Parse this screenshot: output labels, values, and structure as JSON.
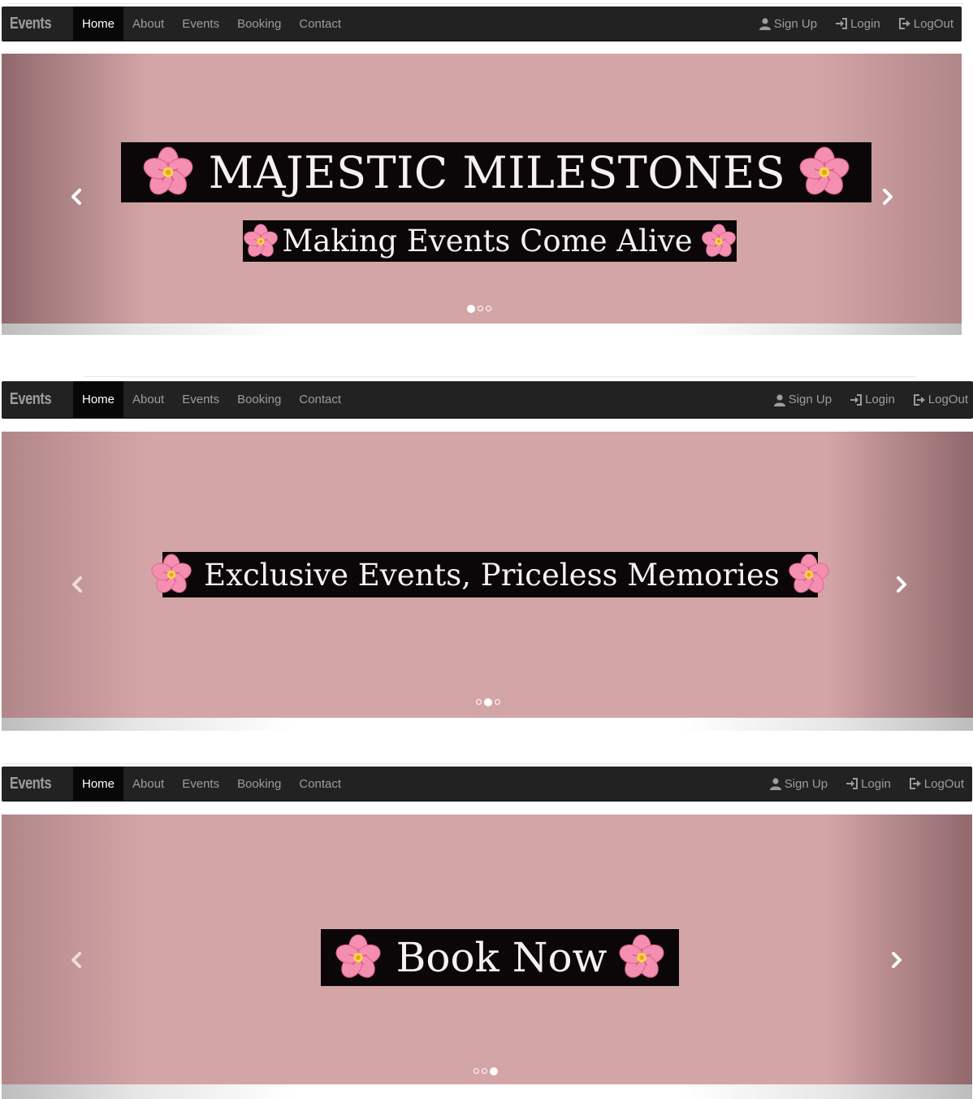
{
  "navbar": {
    "brand": "Events",
    "links": [
      "Home",
      "About",
      "Events",
      "Booking",
      "Contact"
    ],
    "active": "Home",
    "right": {
      "signup": "Sign Up",
      "login": "Login",
      "logout": "LogOut"
    },
    "icons": {
      "signup": "user-icon",
      "login": "login-icon",
      "logout": "logout-icon"
    }
  },
  "slides": [
    {
      "title": "MAJESTIC MILESTONES",
      "subtitle": "Making Events Come Alive",
      "active_indicator": 1
    },
    {
      "title": "Exclusive Events, Priceless Memories",
      "active_indicator": 2
    },
    {
      "title": "Book Now",
      "active_indicator": 3
    }
  ],
  "colors": {
    "navbar_bg": "#222222",
    "slide_bg": "#d3a5a7",
    "caption_bg": "#0b0708",
    "flower_petal": "#f48fb1"
  },
  "icons": {
    "prev": "chevron-left-icon",
    "next": "chevron-right-icon",
    "decoration": "cherry-blossom-icon"
  }
}
